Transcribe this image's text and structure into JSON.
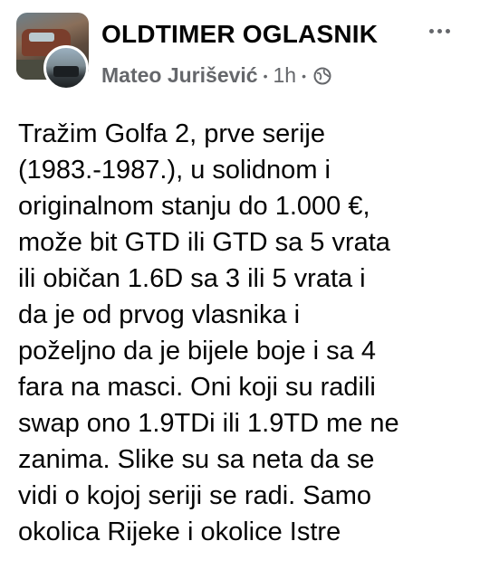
{
  "post": {
    "group_name": "OLDTIMER OGLASNIK",
    "author": "Mateo Jurišević",
    "separator": "•",
    "time": "1h",
    "audience_icon": "globe-icon",
    "text_lines": [
      "Tražim Golfa 2, prve serije",
      "(1983.-1987.), u solidnom i",
      "originalnom stanju do 1.000 €,",
      "može bit GTD ili GTD sa 5 vrata",
      "ili običan 1.6D sa 3 ili 5 vrata i",
      "da je od prvog vlasnika i",
      "poželjno da je bijele boje i sa 4",
      "fara na masci. Oni koji su radili",
      "swap ono 1.9TDi ili 1.9TD me ne",
      "zanima. Slike su sa neta da se",
      "vidi o kojoj seriji se radi. Samo",
      "okolica Rijeke i okolice Istre"
    ]
  },
  "icons": {
    "more": "more-options-icon",
    "globe": "globe-icon"
  },
  "colors": {
    "secondary_text": "#65676b",
    "primary_text": "#050505"
  }
}
